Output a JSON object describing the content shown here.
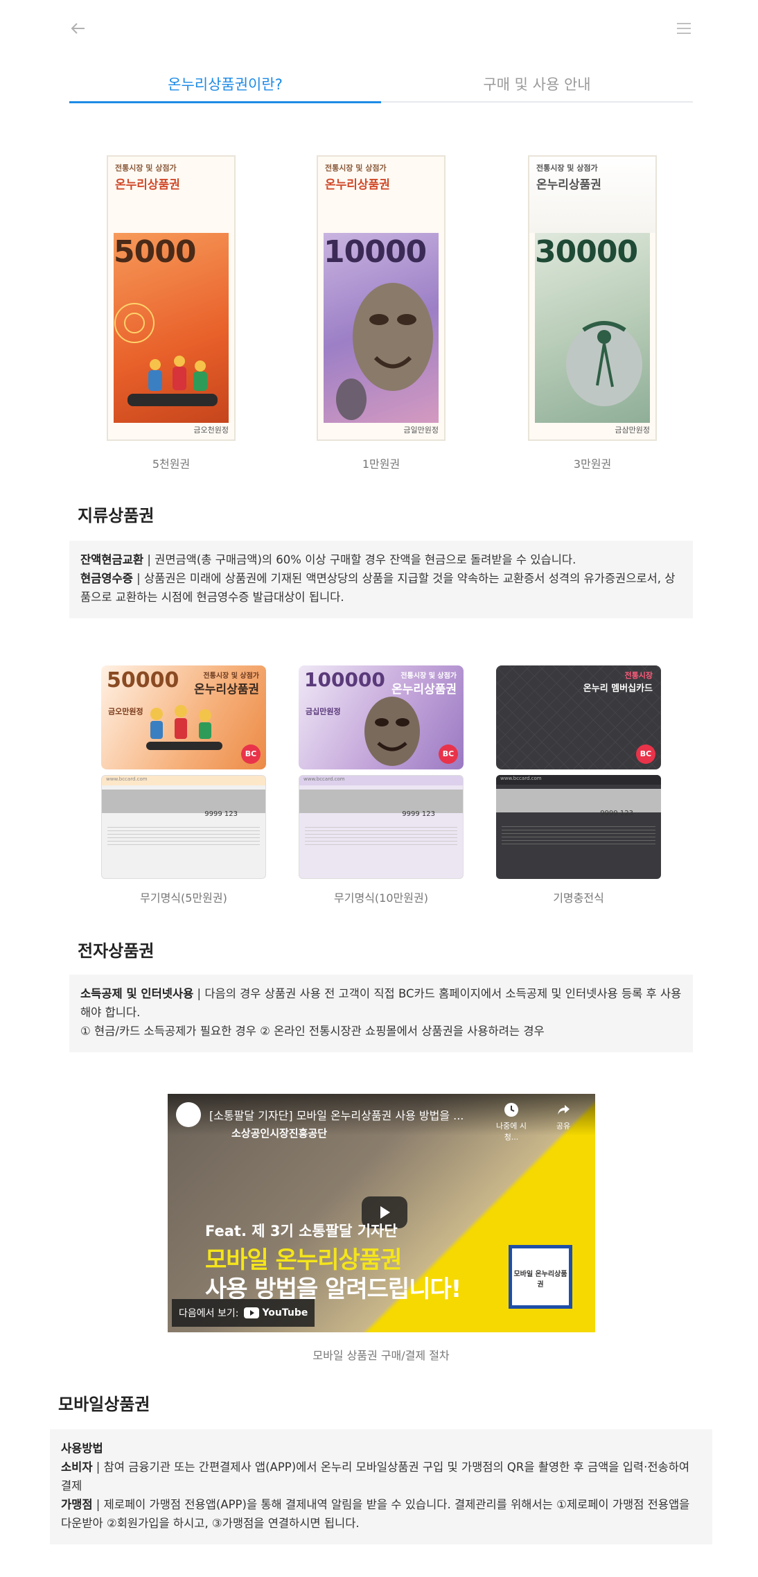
{
  "nav": {
    "tabs": [
      {
        "label": "온누리상품권이란?",
        "active": true
      },
      {
        "label": "구매 및 사용 안내",
        "active": false
      }
    ]
  },
  "paper_vouchers": {
    "items": [
      {
        "sub": "전통시장 및 상점가",
        "name": "온누리상품권",
        "denomination": "5000",
        "face_text": "금오천원정",
        "caption": "5천원권",
        "color": "#f0773a"
      },
      {
        "sub": "전통시장 및 상점가",
        "name": "온누리상품권",
        "denomination": "10000",
        "face_text": "금일만원정",
        "caption": "1만원권",
        "color": "#8c6fb8"
      },
      {
        "sub": "전통시장 및 상점가",
        "name": "온누리상품권",
        "denomination": "30000",
        "face_text": "금삼만원정",
        "caption": "3만원권",
        "color": "#4e8a6b"
      }
    ]
  },
  "paper_section": {
    "title": "지류상품권",
    "line1_term": "잔액현금교환",
    "line1_text": " | 권면금액(총 구매금액)의 60% 이상 구매할 경우 잔액을 현금으로 돌려받을 수 있습니다.",
    "line2_term": "현금영수증",
    "line2_text": " | 상품권은 미래에 상품권에 기재된 액면상당의 상품을 지급할 것을 약속하는 교환증서 성격의 유가증권으로서, 상품으로 교환하는 시점에 현금영수증 발급대상이 됩니다."
  },
  "gift_cards": {
    "items": [
      {
        "amount": "50000",
        "brand_top": "전통시장 및 상점가",
        "brand": "온누리상품권",
        "label": "금오만원정",
        "card_no": "9999 123",
        "caption": "무기명식(5만원권)",
        "color": "#e98a4a"
      },
      {
        "amount": "100000",
        "brand_top": "전통시장 및 상점가",
        "brand": "온누리상품권",
        "label": "금십만원정",
        "card_no": "9999 123",
        "caption": "무기명식(10만원권)",
        "color": "#a77fbf"
      },
      {
        "amount": "",
        "brand_top": "전통시장",
        "brand": "온누리 멤버십카드",
        "label": "",
        "card_no": "9999 123",
        "caption": "기명충전식",
        "color": "#3a3a3e"
      }
    ],
    "bc_logo": "BC",
    "web": "www.bccard.com"
  },
  "electronic_section": {
    "title": "전자상품권",
    "line1_term": "소득공제 및 인터넷사용",
    "line1_text": " | 다음의 경우 상품권 사용 전 고객이 직접 BC카드 홈페이지에서 소득공제 및 인터넷사용 등록 후 사용해야 합니다.",
    "line2_text": "① 현금/카드 소득공제가 필요한 경우 ② 온라인 전통시장관 쇼핑몰에서 상품권을 사용하려는 경우"
  },
  "video": {
    "title": "[소통팔달 기자단] 모바일 온누리상품권 사용 방법을 ...",
    "channel": "소상공인시장진흥공단",
    "watch_later": "나중에 시청...",
    "share": "공유",
    "feat": "Feat. 제 3기 소통팔달 기자단",
    "headline1": "모바일 온누리상품권",
    "headline2": "사용 방법을 알려드립니다!",
    "watch_on": "다음에서 보기:",
    "youtube": "YouTube",
    "badge": "모바일 온누리상품권",
    "caption": "모바일 상품권 구매/결제 절차"
  },
  "mobile_section": {
    "title": "모바일상품권",
    "heading": "사용방법",
    "line1_term": "소비자",
    "line1_text": " | 참여 금융기관 또는 간편결제사 앱(APP)에서 온누리 모바일상품권 구입 및 가맹점의 QR을 촬영한 후 금액을 입력·전송하여 결제",
    "line2_term": "가맹점",
    "line2_text": " | 제로페이 가맹점 전용앱(APP)을 통해 결제내역 알림을 받을 수 있습니다. 결제관리를 위해서는 ①제로페이 가맹점 전용앱을 다운받아 ②회원가입을 하시고, ③가맹점을 연결하시면 됩니다."
  }
}
